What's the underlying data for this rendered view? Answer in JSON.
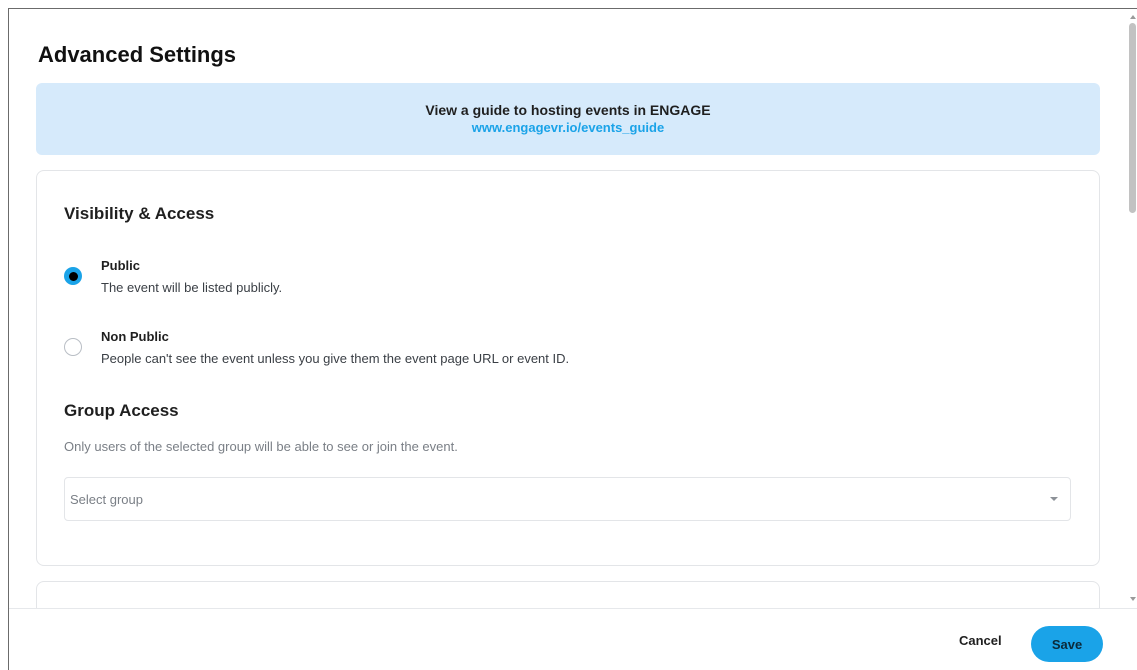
{
  "dialog": {
    "title": "Advanced Settings"
  },
  "banner": {
    "text": "View a guide to hosting events in ENGAGE",
    "link": "www.engagevr.io/events_guide"
  },
  "visibility": {
    "heading": "Visibility & Access",
    "options": [
      {
        "label": "Public",
        "description": "The event will be listed publicly.",
        "selected": true
      },
      {
        "label": "Non Public",
        "description": "People can't see the event unless you give them the event page URL or event ID.",
        "selected": false
      }
    ]
  },
  "group_access": {
    "heading": "Group Access",
    "hint": "Only users of the selected group will be able to see or join the event.",
    "select_placeholder": "Select group"
  },
  "footer": {
    "cancel_label": "Cancel",
    "save_label": "Save"
  },
  "colors": {
    "accent": "#1aa3e8",
    "banner_bg": "#d6eafb"
  },
  "icons": {
    "select_caret": "chevron-down-icon"
  }
}
